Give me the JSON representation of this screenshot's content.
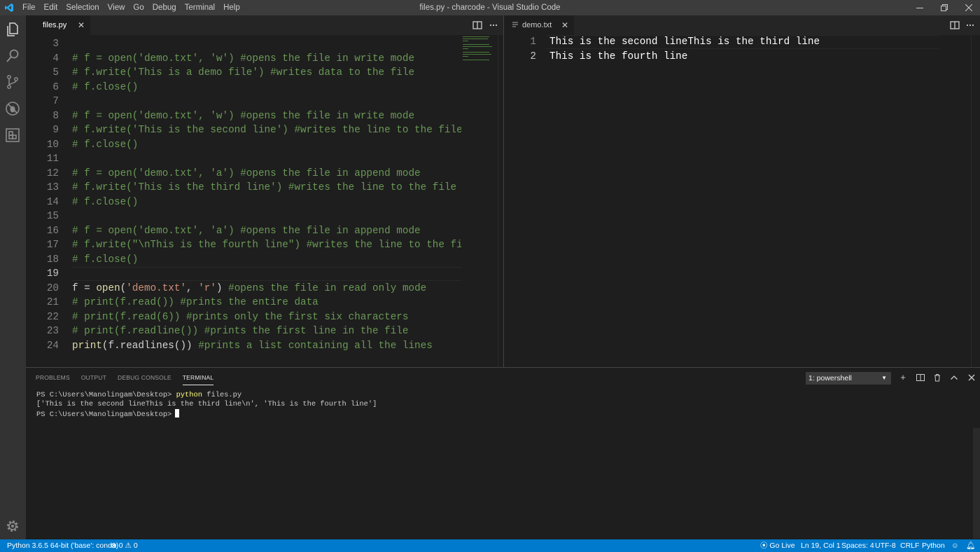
{
  "window": {
    "title": "files.py - charcode - Visual Studio Code"
  },
  "menu": [
    "File",
    "Edit",
    "Selection",
    "View",
    "Go",
    "Debug",
    "Terminal",
    "Help"
  ],
  "editor_left": {
    "tab_label": "files.py",
    "lines": [
      {
        "n": "3",
        "text": ""
      },
      {
        "n": "4",
        "text": "# f = open('demo.txt', 'w') #opens the file in write mode"
      },
      {
        "n": "5",
        "text": "# f.write('This is a demo file') #writes data to the file"
      },
      {
        "n": "6",
        "text": "# f.close()"
      },
      {
        "n": "7",
        "text": ""
      },
      {
        "n": "8",
        "text": "# f = open('demo.txt', 'w') #opens the file in write mode"
      },
      {
        "n": "9",
        "text": "# f.write('This is the second line') #writes the line to the file"
      },
      {
        "n": "10",
        "text": "# f.close()"
      },
      {
        "n": "11",
        "text": ""
      },
      {
        "n": "12",
        "text": "# f = open('demo.txt', 'a') #opens the file in append mode"
      },
      {
        "n": "13",
        "text": "# f.write('This is the third line') #writes the line to the file"
      },
      {
        "n": "14",
        "text": "# f.close()"
      },
      {
        "n": "15",
        "text": ""
      },
      {
        "n": "16",
        "text": "# f = open('demo.txt', 'a') #opens the file in append mode"
      },
      {
        "n": "17",
        "text": "# f.write(\"\\nThis is the fourth line\") #writes the line to the file"
      },
      {
        "n": "18",
        "text": "# f.close()"
      },
      {
        "n": "19",
        "text": ""
      },
      {
        "n": "20",
        "text": "f = open('demo.txt', 'r') #opens the file in read only mode"
      },
      {
        "n": "21",
        "text": "# print(f.read()) #prints the entire data"
      },
      {
        "n": "22",
        "text": "# print(f.read(6)) #prints only the first six characters"
      },
      {
        "n": "23",
        "text": "# print(f.readline()) #prints the first line in the file"
      },
      {
        "n": "24",
        "text": "print(f.readlines()) #prints a list containing all the lines"
      }
    ],
    "active_line": "19"
  },
  "editor_right": {
    "tab_label": "demo.txt",
    "lines": [
      {
        "n": "1",
        "text": "This is the second lineThis is the third line"
      },
      {
        "n": "2",
        "text": "This is the fourth line"
      }
    ]
  },
  "panel": {
    "tabs": [
      "PROBLEMS",
      "OUTPUT",
      "DEBUG CONSOLE",
      "TERMINAL"
    ],
    "active_tab": "TERMINAL",
    "terminal_select": "1: powershell",
    "terminal": {
      "prompt": "PS C:\\Users\\Manolingam\\Desktop>",
      "cmd_keyword": "python",
      "cmd_args": "files.py",
      "output": "['This is the second lineThis is the third line\\n', 'This is the fourth line']"
    }
  },
  "statusbar": {
    "python": "Python 3.6.5 64-bit ('base': conda)",
    "errors": "0",
    "warnings": "0",
    "go_live": "Go Live",
    "position": "Ln 19, Col 1",
    "spaces": "Spaces: 4",
    "encoding": "UTF-8",
    "eol": "CRLF",
    "language": "Python"
  },
  "colors": {
    "statusbar": "#007acc",
    "comment": "#6a9955",
    "string": "#ce9178",
    "function": "#dcdcaa",
    "titlebar": "#3c3c3c"
  }
}
